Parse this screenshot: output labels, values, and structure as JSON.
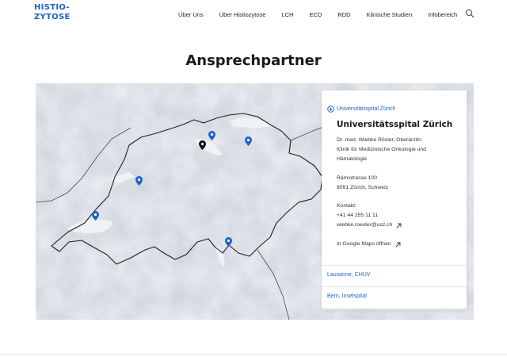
{
  "brand": {
    "logo_line1": "HISTIO-",
    "logo_line2": "ZYTOSE",
    "accent": "#1c63c9"
  },
  "nav": {
    "items": [
      "Über Uns",
      "Über Histiozytose",
      "LCH",
      "ECD",
      "RDD",
      "Klinische Studien",
      "Infobereich"
    ],
    "search_icon": "search-icon"
  },
  "page": {
    "title": "Ansprechpartner"
  },
  "panel": {
    "active_location": "Universitätsspital Zürich",
    "title": "Universitätsspital Zürich",
    "contact_person": "Dr. med. Wiebke Rösler, Oberärztin",
    "department_line1": "Klinik für Medizinische Onkologie und",
    "department_line2": "Hämatologie",
    "street": "Rämistrasse 100",
    "city": "8091 Zürich, Schweiz",
    "contact_label": "Kontakt:",
    "phone": "+41 44 255 11 11",
    "email": "wiebke.roesler@usz.ch",
    "maps_link": "In Google Maps öffnen",
    "other_locations": [
      "Lausanne, CHUV",
      "Bern, Inselspital"
    ]
  }
}
